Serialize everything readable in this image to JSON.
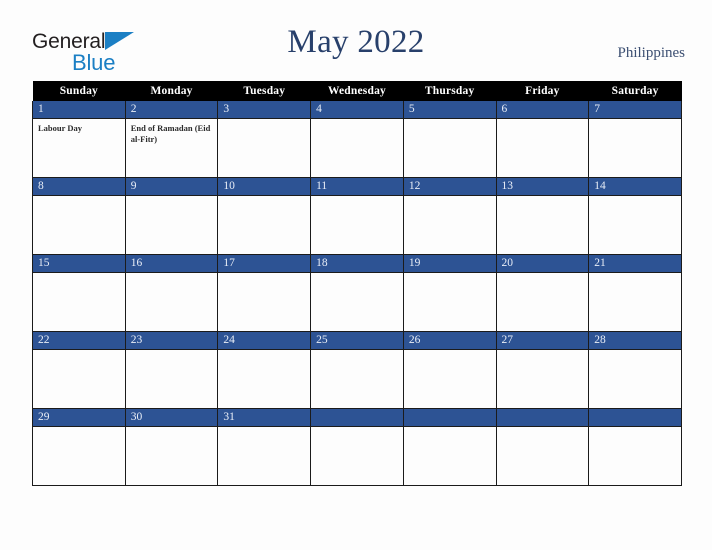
{
  "brand": {
    "name_part1": "General",
    "name_part2": "Blue",
    "triangle_icon": "triangle-icon",
    "accent_blue": "#1b7fc4",
    "text_dark": "#231f20"
  },
  "header": {
    "title": "May 2022",
    "country": "Philippines",
    "title_color": "#28406b"
  },
  "calendar": {
    "accent_date_bar": "#2d5394",
    "header_bg": "#000000",
    "weekday_headers": [
      "Sunday",
      "Monday",
      "Tuesday",
      "Wednesday",
      "Thursday",
      "Friday",
      "Saturday"
    ],
    "weeks": [
      [
        {
          "day": "1",
          "events": [
            "Labour Day"
          ]
        },
        {
          "day": "2",
          "events": [
            "End of Ramadan (Eid al-Fitr)"
          ]
        },
        {
          "day": "3",
          "events": []
        },
        {
          "day": "4",
          "events": []
        },
        {
          "day": "5",
          "events": []
        },
        {
          "day": "6",
          "events": []
        },
        {
          "day": "7",
          "events": []
        }
      ],
      [
        {
          "day": "8",
          "events": []
        },
        {
          "day": "9",
          "events": []
        },
        {
          "day": "10",
          "events": []
        },
        {
          "day": "11",
          "events": []
        },
        {
          "day": "12",
          "events": []
        },
        {
          "day": "13",
          "events": []
        },
        {
          "day": "14",
          "events": []
        }
      ],
      [
        {
          "day": "15",
          "events": []
        },
        {
          "day": "16",
          "events": []
        },
        {
          "day": "17",
          "events": []
        },
        {
          "day": "18",
          "events": []
        },
        {
          "day": "19",
          "events": []
        },
        {
          "day": "20",
          "events": []
        },
        {
          "day": "21",
          "events": []
        }
      ],
      [
        {
          "day": "22",
          "events": []
        },
        {
          "day": "23",
          "events": []
        },
        {
          "day": "24",
          "events": []
        },
        {
          "day": "25",
          "events": []
        },
        {
          "day": "26",
          "events": []
        },
        {
          "day": "27",
          "events": []
        },
        {
          "day": "28",
          "events": []
        }
      ],
      [
        {
          "day": "29",
          "events": []
        },
        {
          "day": "30",
          "events": []
        },
        {
          "day": "31",
          "events": []
        },
        {
          "day": "",
          "events": []
        },
        {
          "day": "",
          "events": []
        },
        {
          "day": "",
          "events": []
        },
        {
          "day": "",
          "events": []
        }
      ]
    ]
  }
}
